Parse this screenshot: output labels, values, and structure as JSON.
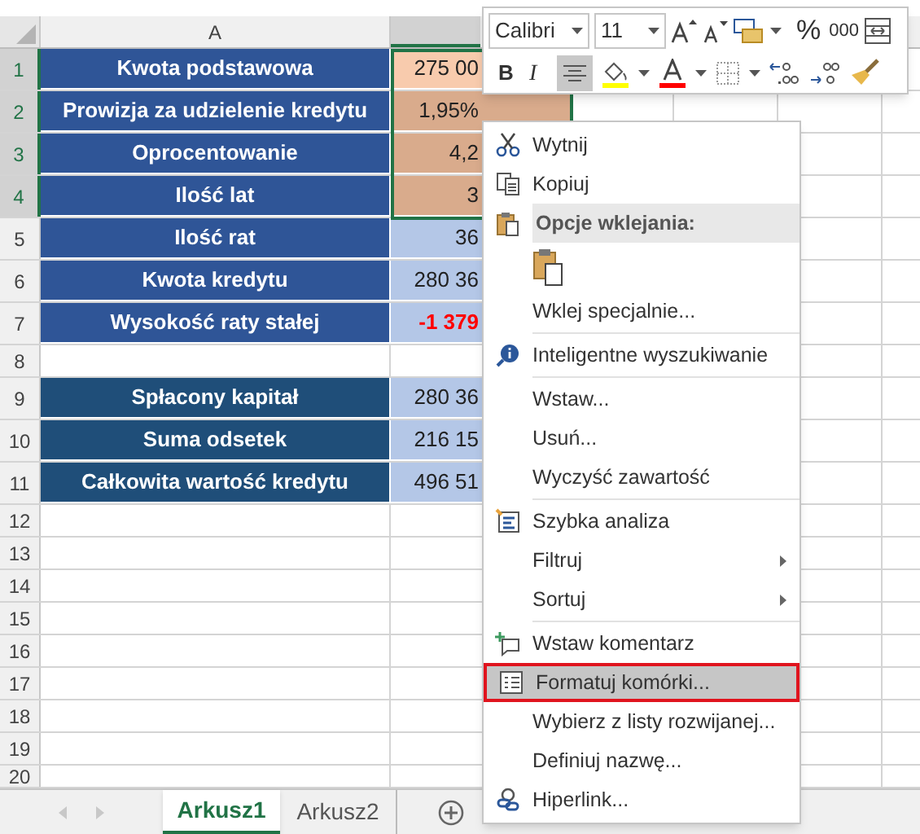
{
  "sheet": {
    "column_headers": [
      {
        "label": "A",
        "selected": false
      }
    ],
    "rows": [
      {
        "number": "1",
        "selected": true,
        "kind": "input",
        "label": "Kwota podstawowa",
        "value": "275 00",
        "value_selected": true,
        "active": true,
        "negative": false
      },
      {
        "number": "2",
        "selected": true,
        "kind": "input",
        "label": "Prowizja za udzielenie kredytu",
        "value": "1,95%",
        "value_selected": true,
        "active": false,
        "negative": false
      },
      {
        "number": "3",
        "selected": true,
        "kind": "input",
        "label": "Oprocentowanie",
        "value": "4,2",
        "value_selected": true,
        "active": false,
        "negative": false
      },
      {
        "number": "4",
        "selected": true,
        "kind": "input",
        "label": "Ilość lat",
        "value": "3",
        "value_selected": true,
        "active": false,
        "negative": false
      },
      {
        "number": "5",
        "selected": false,
        "kind": "computed",
        "label": "Ilość rat",
        "value": "36",
        "value_selected": false,
        "negative": false
      },
      {
        "number": "6",
        "selected": false,
        "kind": "computed",
        "label": "Kwota kredytu",
        "value": "280 36",
        "value_selected": false,
        "negative": false
      },
      {
        "number": "7",
        "selected": false,
        "kind": "computed",
        "label": "Wysokość raty stałej",
        "value": "-1 379",
        "value_selected": false,
        "negative": true
      },
      {
        "number": "8",
        "selected": false,
        "kind": "empty"
      },
      {
        "number": "9",
        "selected": false,
        "kind": "summary",
        "label": "Spłacony kapitał",
        "value": "280 36",
        "value_selected": false,
        "negative": false
      },
      {
        "number": "10",
        "selected": false,
        "kind": "summary",
        "label": "Suma odsetek",
        "value": "216 15",
        "value_selected": false,
        "negative": false
      },
      {
        "number": "11",
        "selected": false,
        "kind": "summary",
        "label": "Całkowita wartość kredytu",
        "value": "496 51",
        "value_selected": false,
        "negative": false
      },
      {
        "number": "12",
        "selected": false,
        "kind": "empty"
      },
      {
        "number": "13",
        "selected": false,
        "kind": "empty"
      },
      {
        "number": "14",
        "selected": false,
        "kind": "empty"
      },
      {
        "number": "15",
        "selected": false,
        "kind": "empty"
      },
      {
        "number": "16",
        "selected": false,
        "kind": "empty"
      },
      {
        "number": "17",
        "selected": false,
        "kind": "empty"
      },
      {
        "number": "18",
        "selected": false,
        "kind": "empty"
      },
      {
        "number": "19",
        "selected": false,
        "kind": "empty"
      },
      {
        "number": "20",
        "selected": false,
        "kind": "empty"
      }
    ]
  },
  "mini_toolbar": {
    "font": "Calibri",
    "size": "11",
    "percent": "%",
    "thousands": "000",
    "bold": "B",
    "italic": "I",
    "align_selected": true
  },
  "context_menu": [
    {
      "kind": "item",
      "label": "Wytnij",
      "highlighted": false,
      "submenu": false
    },
    {
      "kind": "item",
      "label": "Kopiuj",
      "highlighted": false,
      "submenu": false
    },
    {
      "kind": "header",
      "label": "Opcje wklejania:"
    },
    {
      "kind": "paste"
    },
    {
      "kind": "item",
      "label": "Wklej specjalnie...",
      "highlighted": false,
      "submenu": false
    },
    {
      "kind": "separator"
    },
    {
      "kind": "item",
      "label": "Inteligentne wyszukiwanie",
      "highlighted": false,
      "submenu": false
    },
    {
      "kind": "separator"
    },
    {
      "kind": "item",
      "label": "Wstaw...",
      "highlighted": false,
      "submenu": false
    },
    {
      "kind": "item",
      "label": "Usuń...",
      "highlighted": false,
      "submenu": false
    },
    {
      "kind": "item",
      "label": "Wyczyść zawartość",
      "highlighted": false,
      "submenu": false
    },
    {
      "kind": "separator"
    },
    {
      "kind": "item",
      "label": "Szybka analiza",
      "highlighted": false,
      "submenu": false
    },
    {
      "kind": "item",
      "label": "Filtruj",
      "highlighted": false,
      "submenu": true
    },
    {
      "kind": "item",
      "label": "Sortuj",
      "highlighted": false,
      "submenu": true
    },
    {
      "kind": "separator"
    },
    {
      "kind": "item",
      "label": "Wstaw komentarz",
      "highlighted": false,
      "submenu": false
    },
    {
      "kind": "item",
      "label": "Formatuj komórki...",
      "highlighted": true,
      "submenu": false
    },
    {
      "kind": "item",
      "label": "Wybierz z listy rozwijanej...",
      "highlighted": false,
      "submenu": false
    },
    {
      "kind": "item",
      "label": "Definiuj nazwę...",
      "highlighted": false,
      "submenu": false
    },
    {
      "kind": "item",
      "label": "Hiperlink...",
      "highlighted": false,
      "submenu": false
    }
  ],
  "sheet_tabs": [
    {
      "label": "Arkusz1",
      "selected": true
    },
    {
      "label": "Arkusz2",
      "selected": false
    }
  ]
}
